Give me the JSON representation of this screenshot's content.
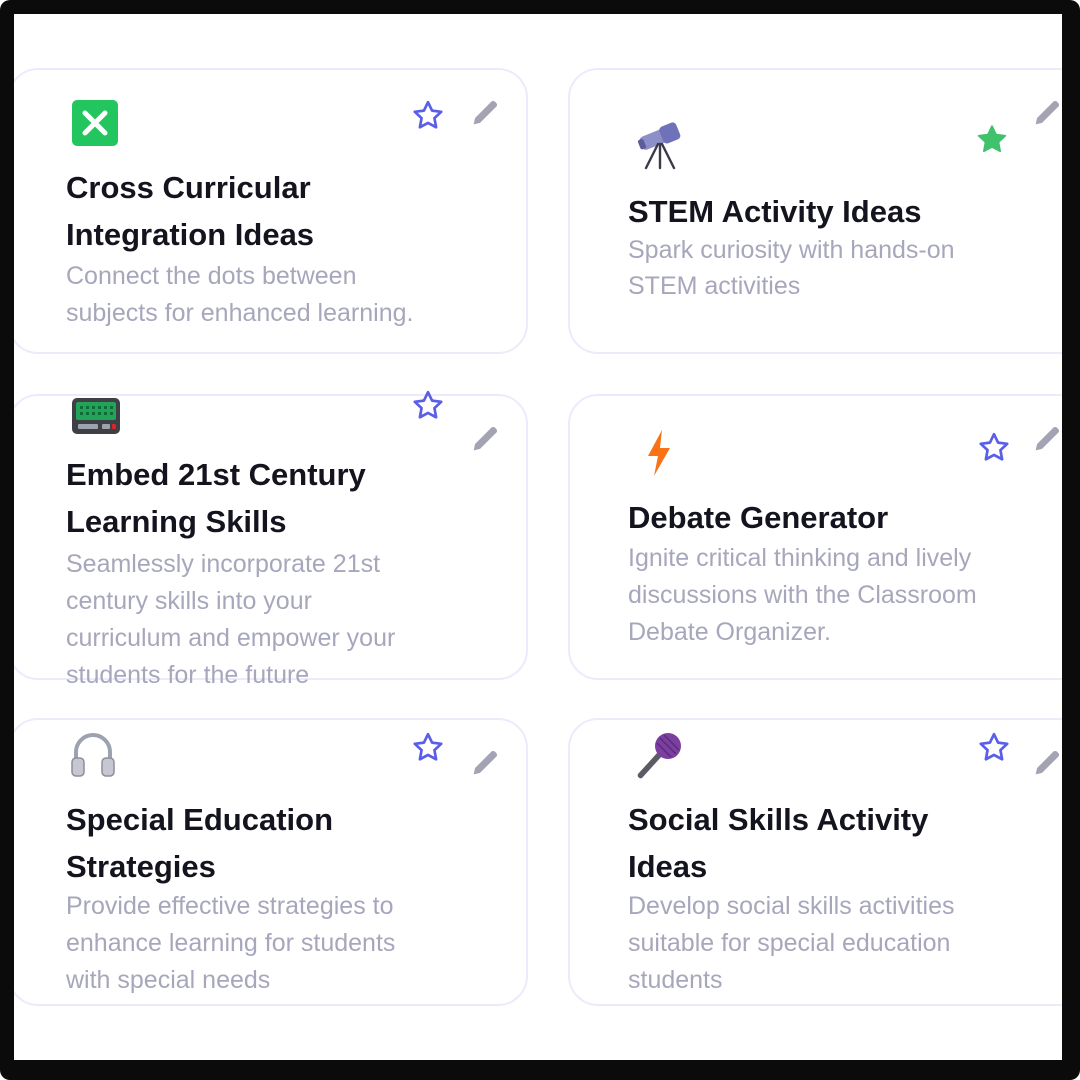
{
  "cards": [
    {
      "icon": "cross-mark-icon",
      "title_line1": "Cross Curricular",
      "title_line2": "Integration Ideas",
      "desc": [
        "Connect the dots between",
        "subjects for enhanced learning."
      ],
      "favorited": false
    },
    {
      "icon": "telescope-icon",
      "title_line1": "STEM Activity Ideas",
      "desc": [
        "Spark curiosity with hands-on",
        "STEM activities"
      ],
      "favorited": true
    },
    {
      "icon": "keyboard-device-icon",
      "title_line1": "Embed 21st Century",
      "title_line2": "Learning Skills",
      "desc": [
        "Seamlessly incorporate 21st",
        "century skills into your",
        "curriculum and empower your",
        "students for the future"
      ],
      "favorited": false
    },
    {
      "icon": "lightning-icon",
      "title_line1": "Debate Generator",
      "desc": [
        "Ignite critical thinking and lively",
        "discussions with the Classroom",
        "Debate Organizer."
      ],
      "favorited": false
    },
    {
      "icon": "headphones-icon",
      "title_line1": "Special Education",
      "title_line2": "Strategies",
      "desc": [
        "Provide effective strategies to",
        "enhance learning for students",
        "with special needs"
      ],
      "favorited": false
    },
    {
      "icon": "microphone-icon",
      "title_line1": "Social Skills Activity",
      "title_line2": "Ideas",
      "desc": [
        "Develop social skills activities",
        "suitable for special education",
        "students"
      ],
      "favorited": false
    }
  ],
  "colors": {
    "star_outline": "#5a5ee8",
    "star_filled": "#3fc26b",
    "pencil": "#a3a3b3",
    "title": "#14141f",
    "description": "#a7a7bc",
    "card_border": "#ecebfb"
  }
}
